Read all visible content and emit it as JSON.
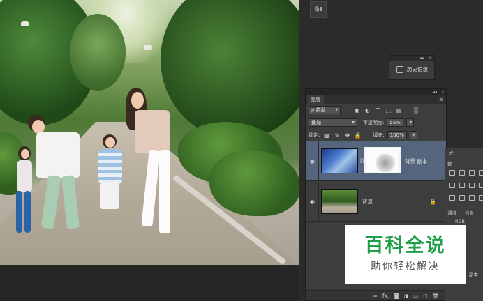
{
  "canvas": {
    "image": "family-walking-photo"
  },
  "mini_button": {
    "label": "命Ⅱ"
  },
  "history_panel": {
    "header_collapse": "▸▸",
    "header_close": "×",
    "label": "历史记录",
    "icon": "history-icon"
  },
  "layers_panel": {
    "header_collapse": "◂◂",
    "header_close": "×",
    "tab_label": "图层",
    "menu": "≡",
    "filter": {
      "label": "ρ 类型",
      "icons": [
        "image-filter-icon",
        "adjustment-filter-icon",
        "type-filter-icon",
        "shape-filter-icon",
        "smart-object-filter-icon"
      ]
    },
    "blend_mode": "叠加",
    "opacity": {
      "label": "不透明度:",
      "value": "55%"
    },
    "lock": {
      "label": "锁定:",
      "icons": [
        "lock-transparent-icon",
        "lock-image-icon",
        "lock-position-icon",
        "lock-all-icon"
      ]
    },
    "fill": {
      "label": "填充:",
      "value": "100%"
    },
    "layers": [
      {
        "name": "背景 副本",
        "visible": true,
        "selected": true,
        "has_mask": true
      },
      {
        "name": "背景",
        "visible": true,
        "selected": false,
        "locked": true
      }
    ],
    "footer_icons": [
      "link-layers-icon",
      "fx-icon",
      "add-mask-icon",
      "adjustment-layer-icon",
      "group-folder-icon",
      "new-layer-icon",
      "trash-icon"
    ],
    "footer_glyphs": [
      "∞",
      "fx.",
      "◙",
      "◑",
      "▭",
      "◻",
      "🗑"
    ]
  },
  "right_panel": {
    "tab_style": "式",
    "tab_adjust": "整",
    "tab_channels": "通道",
    "tab_info": "信息",
    "channel_rgb": "RGB",
    "layer_name_partial": "副本"
  },
  "watermark": {
    "title": "百科全说",
    "subtitle": "助你轻松解决"
  },
  "colors": {
    "panel_bg": "#3d3d3d",
    "selected_layer": "#55657d",
    "watermark_green": "#1f9f48"
  }
}
